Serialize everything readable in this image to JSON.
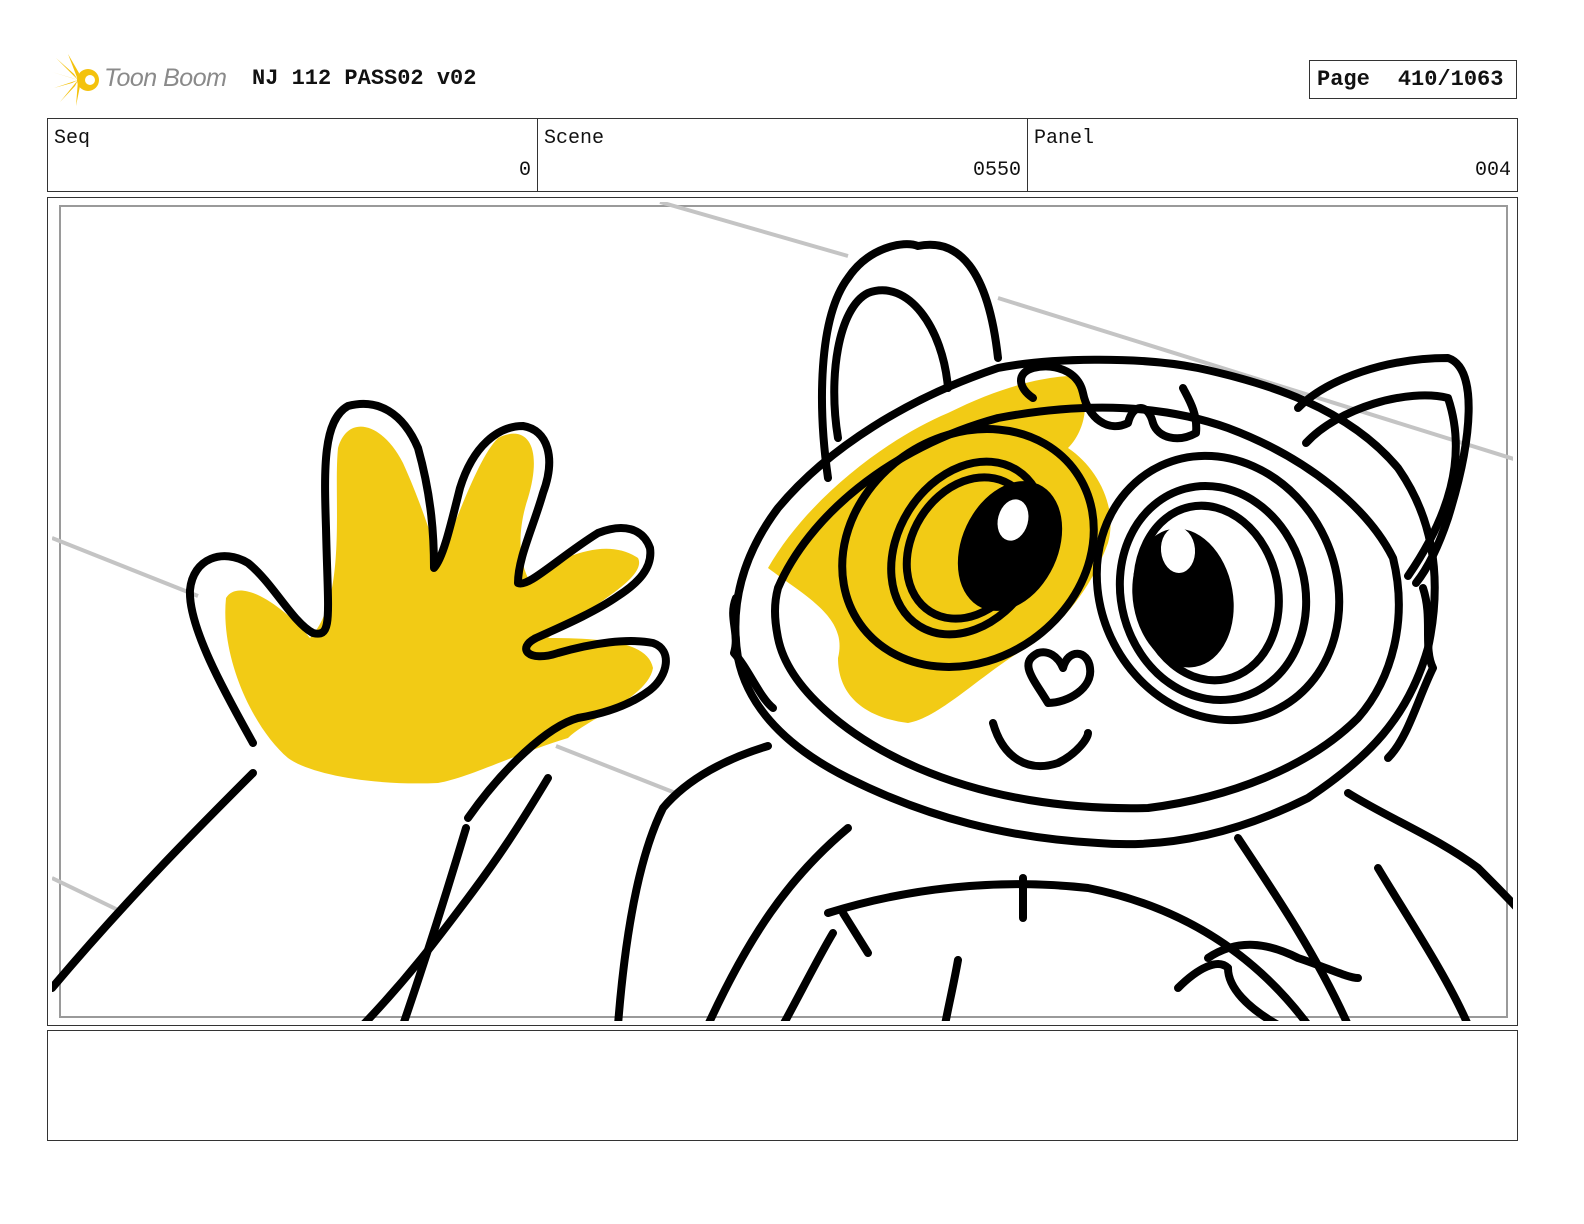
{
  "header": {
    "logo_text": "Toon Boom",
    "title": "NJ 112 PASS02 v02",
    "page_label": "Page",
    "page_number": "410/1063"
  },
  "info": {
    "seq_label": "Seq",
    "seq_value": "0",
    "scene_label": "Scene",
    "scene_value": "0550",
    "panel_label": "Panel",
    "panel_value": "004"
  },
  "panel": {
    "icon": "raccoon-waving-sketch",
    "fill_color": "#f2cb15",
    "line_color": "#000000"
  },
  "notes": {
    "text": ""
  }
}
